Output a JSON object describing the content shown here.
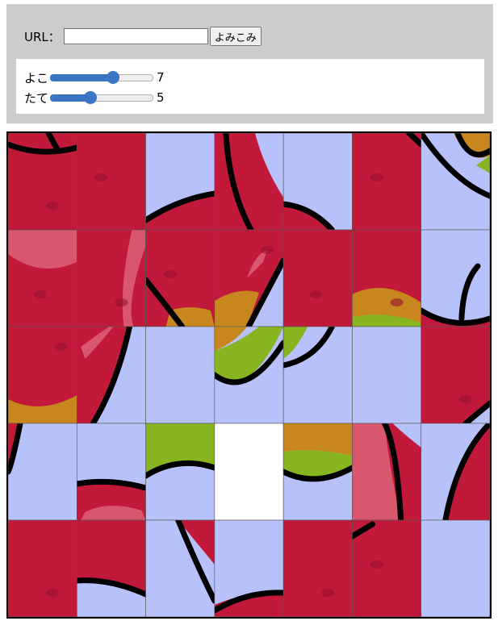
{
  "url_label": "URL：",
  "url_value": "",
  "load_button": "よみこみ",
  "sliders": [
    {
      "label": "よこ",
      "value": 7,
      "min": 2,
      "max": 10
    },
    {
      "label": "たて",
      "value": 5,
      "min": 2,
      "max": 10
    }
  ],
  "puzzle": {
    "cols": 7,
    "rows": 5,
    "empty_tile": {
      "col": 3,
      "row": 3
    },
    "colors": {
      "red": "#c2193a",
      "blue": "#b8c2fa",
      "orange": "#c8861e",
      "green": "#86b520",
      "pink": "#d8576e",
      "outline": "#000000",
      "empty": "#ffffff"
    }
  }
}
